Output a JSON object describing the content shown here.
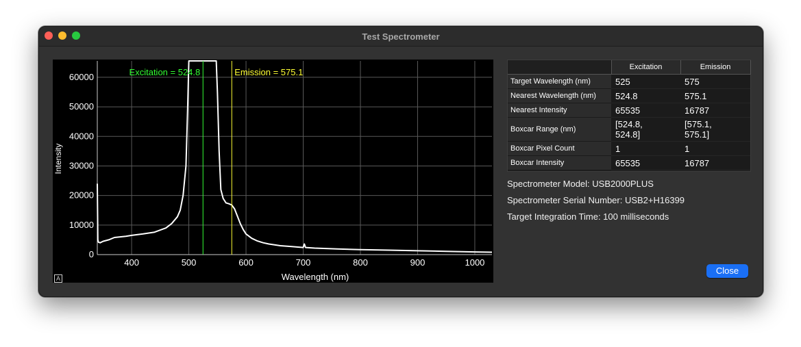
{
  "window": {
    "title": "Test Spectrometer"
  },
  "plot": {
    "excitation_label": "Excitation = 524.8",
    "emission_label": "Emission = 575.1",
    "autoscale_label": "A"
  },
  "chart_data": {
    "type": "line",
    "xlabel": "Wavelength (nm)",
    "ylabel": "Intensity",
    "xlim": [
      340,
      1030
    ],
    "ylim": [
      0,
      65535
    ],
    "x_ticks": [
      400,
      500,
      600,
      700,
      800,
      900,
      1000
    ],
    "y_ticks": [
      0,
      10000,
      20000,
      30000,
      40000,
      50000,
      60000
    ],
    "grid": true,
    "markers": [
      {
        "name": "Excitation",
        "x": 524.8,
        "color": "#33ff33"
      },
      {
        "name": "Emission",
        "x": 575.1,
        "color": "#ffff33"
      }
    ],
    "series": [
      {
        "color": "#ffffff",
        "x": [
          340,
          341,
          342,
          345,
          350,
          360,
          370,
          380,
          390,
          400,
          420,
          440,
          460,
          470,
          480,
          485,
          490,
          495,
          498,
          500,
          503,
          505,
          540,
          548,
          550,
          553,
          556,
          560,
          565,
          570,
          575,
          580,
          585,
          590,
          595,
          600,
          610,
          620,
          630,
          640,
          650,
          660,
          680,
          700,
          702,
          704,
          720,
          760,
          800,
          850,
          900,
          950,
          1000,
          1030
        ],
        "y": [
          24000,
          5000,
          4200,
          4000,
          4500,
          5000,
          5800,
          6000,
          6200,
          6500,
          7000,
          7600,
          9000,
          10500,
          12800,
          15000,
          20000,
          30000,
          50000,
          65535,
          65535,
          65535,
          65535,
          65535,
          55000,
          35000,
          22000,
          19000,
          17500,
          17200,
          16787,
          15500,
          13000,
          10500,
          8500,
          7000,
          5500,
          4600,
          4000,
          3600,
          3300,
          3000,
          2700,
          2400,
          3600,
          2400,
          2200,
          1900,
          1700,
          1500,
          1300,
          1100,
          900,
          800
        ]
      }
    ]
  },
  "table": {
    "columns": [
      "Excitation",
      "Emission"
    ],
    "rows": [
      {
        "label": "Target Wavelength (nm)",
        "excitation": "525",
        "emission": "575"
      },
      {
        "label": "Nearest Wavelength (nm)",
        "excitation": "524.8",
        "emission": "575.1"
      },
      {
        "label": "Nearest Intensity",
        "excitation": "65535",
        "emission": "16787"
      },
      {
        "label": "Boxcar Range (nm)",
        "excitation_line1": "[524.8,",
        "excitation_line2": "524.8]",
        "emission_line1": "[575.1,",
        "emission_line2": "575.1]"
      },
      {
        "label": "Boxcar Pixel Count",
        "excitation": "1",
        "emission": "1"
      },
      {
        "label": "Boxcar Intensity",
        "excitation": "65535",
        "emission": "16787"
      }
    ]
  },
  "info": {
    "model": "Spectrometer Model: USB2000PLUS",
    "serial": "Spectrometer Serial Number: USB2+H16399",
    "integration": "Target Integration Time: 100 milliseconds"
  },
  "buttons": {
    "close_label": "Close"
  }
}
